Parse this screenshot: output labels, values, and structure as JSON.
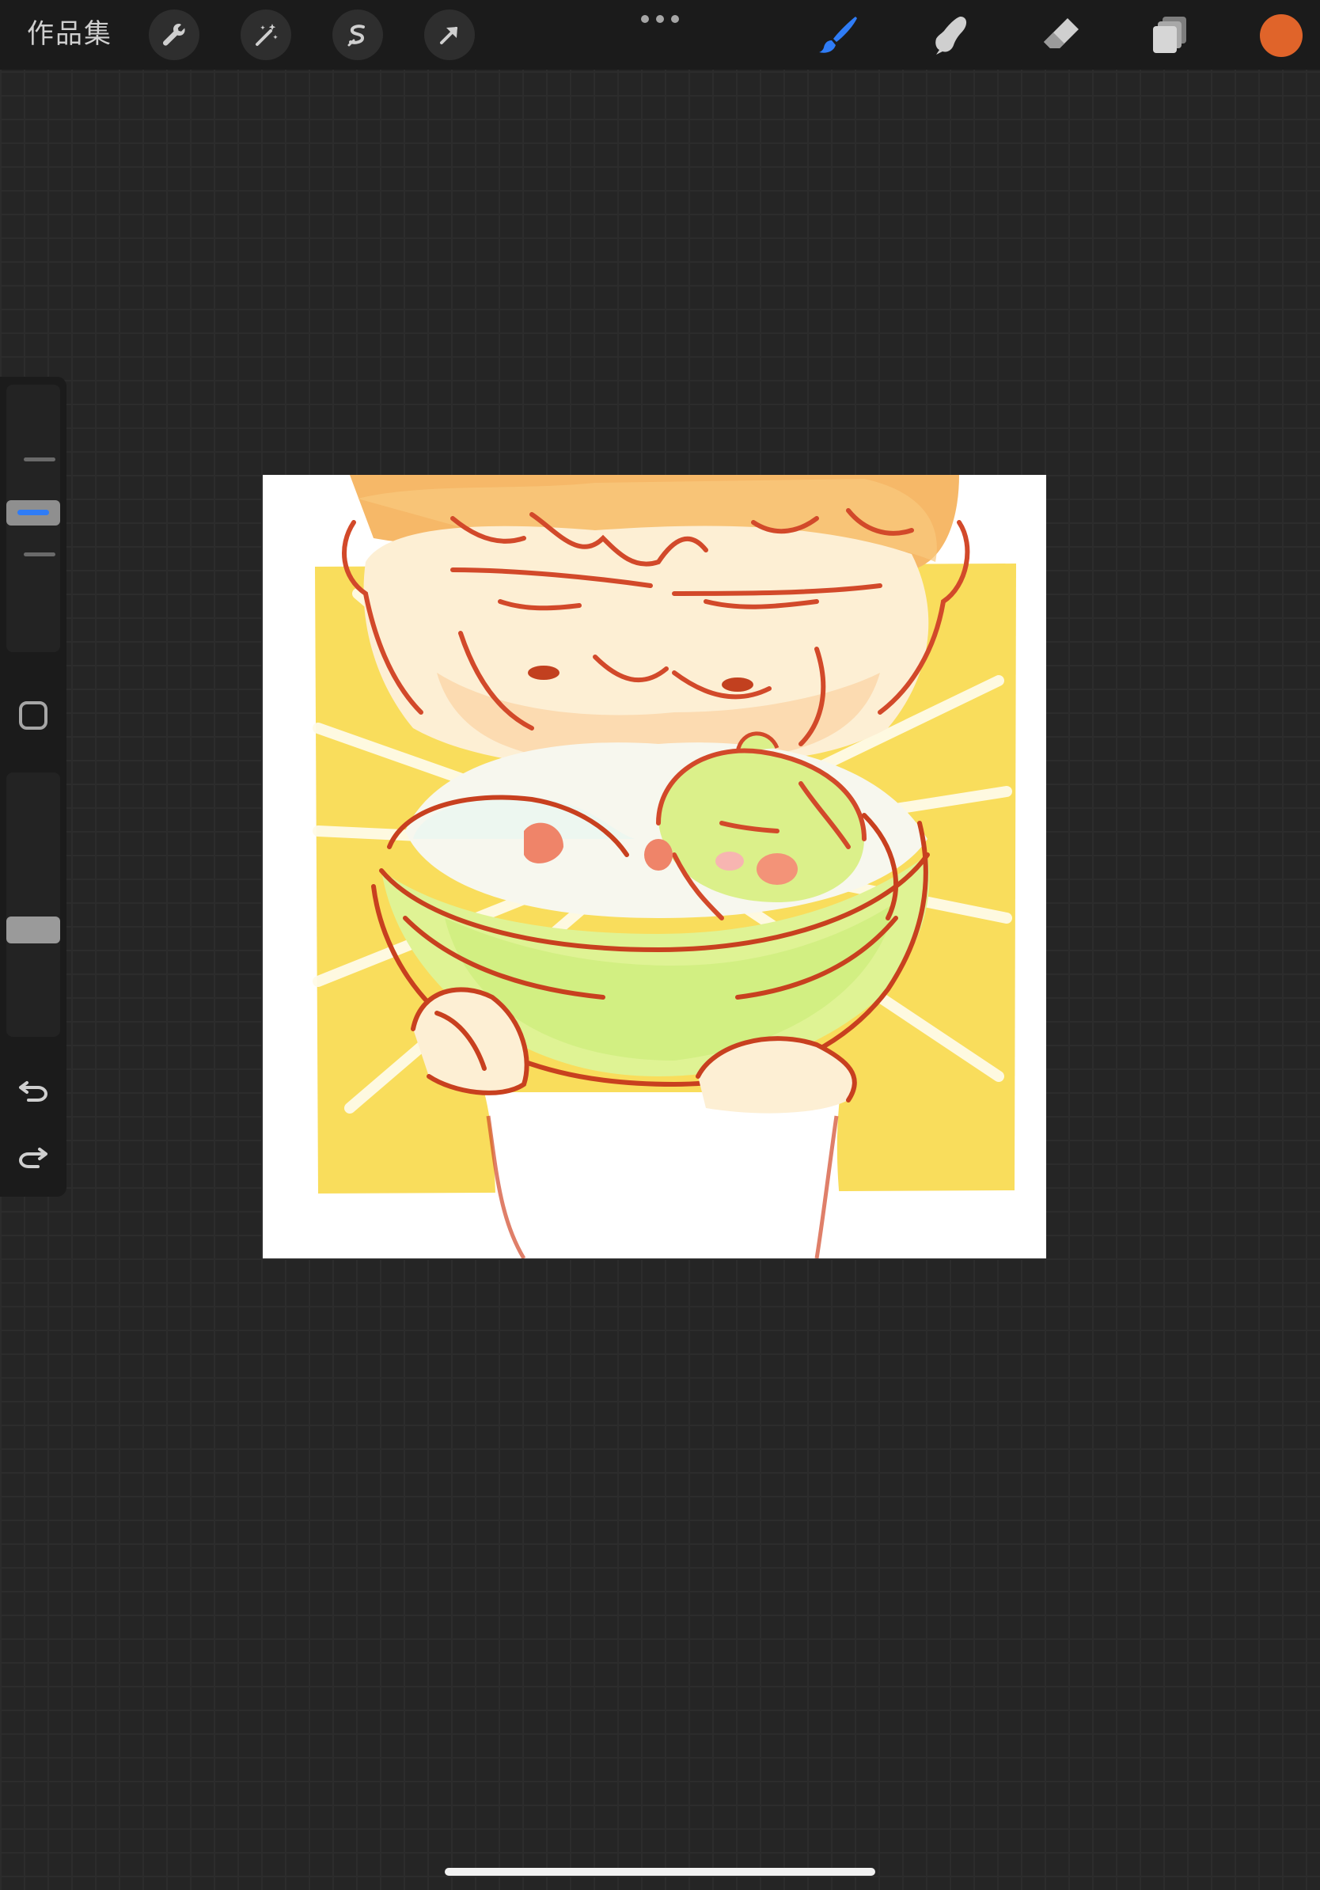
{
  "topbar": {
    "gallery_label": "作品集",
    "left_tools": [
      {
        "name": "actions",
        "icon": "wrench-icon"
      },
      {
        "name": "adjustments",
        "icon": "magic-wand-icon"
      },
      {
        "name": "selection",
        "icon": "selection-s-icon"
      },
      {
        "name": "transform",
        "icon": "arrow-cursor-icon"
      }
    ],
    "right_tools": [
      {
        "name": "brush",
        "icon": "brush-icon",
        "active": true
      },
      {
        "name": "smudge",
        "icon": "smudge-finger-icon",
        "active": false
      },
      {
        "name": "eraser",
        "icon": "eraser-icon",
        "active": false
      },
      {
        "name": "layers",
        "icon": "layers-icon",
        "active": false
      }
    ],
    "current_color": "#e0642a"
  },
  "sidebar": {
    "brush_size_level": 0.38,
    "opacity_level": 0.62,
    "modifier_icon": "square-modifier-icon",
    "undo_icon": "undo-arrow-icon",
    "redo_icon": "redo-arrow-icon"
  },
  "colors": {
    "accent": "#2f7cf6",
    "toolbar_bg": "#1b1b1b",
    "workspace_bg": "#252525",
    "icon_gray": "#a6a6a6"
  },
  "canvas": {
    "artwork": "sketch-illustration"
  }
}
